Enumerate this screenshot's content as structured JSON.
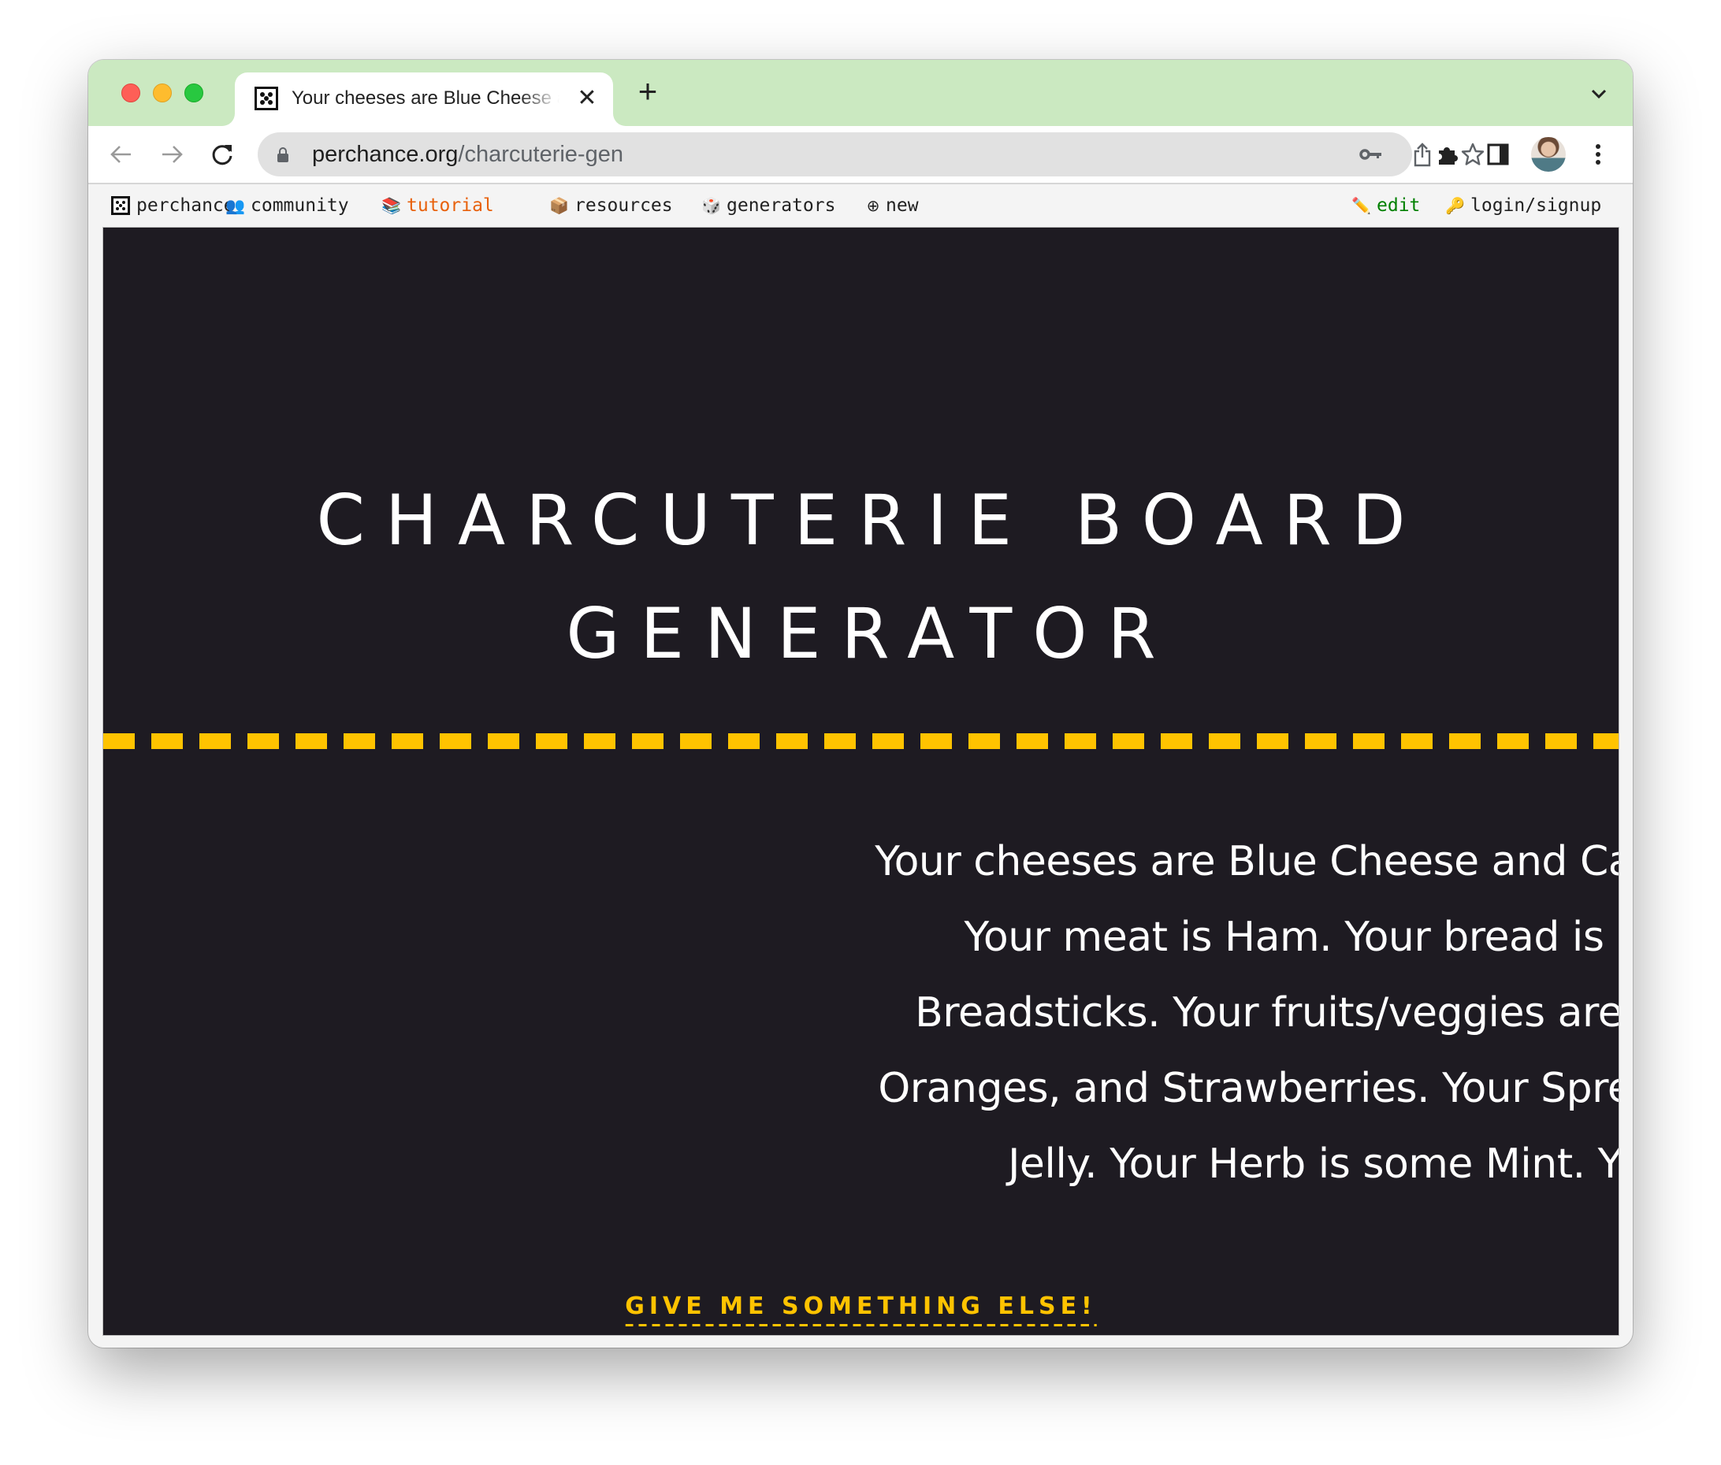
{
  "browser": {
    "tab": {
      "title": "Your cheeses are Blue Cheese and Camembert.",
      "favicon": "dice-icon",
      "close_label": "✕"
    },
    "new_tab_label": "+",
    "address": {
      "domain": "perchance.org",
      "path": "/charcuterie-gen"
    },
    "omnibox_icons": [
      "key-icon",
      "share-icon",
      "star-icon"
    ],
    "toolbar_icons": [
      "extensions-icon",
      "side-panel-icon",
      "profile-avatar",
      "menu-icon"
    ]
  },
  "bookmarks": {
    "left": [
      {
        "label": "perchance",
        "icon": "dice-icon",
        "color": "#222222"
      },
      {
        "label": "community",
        "icon": "👥",
        "color": "#222222"
      },
      {
        "label": "tutorial",
        "icon": "📚",
        "color": "#e8610c"
      },
      {
        "label": "resources",
        "icon": "📦",
        "color": "#222222"
      },
      {
        "label": "generators",
        "icon": "🎲",
        "color": "#222222"
      },
      {
        "label": "new",
        "icon": "⊕",
        "color": "#222222"
      }
    ],
    "right": [
      {
        "label": "edit",
        "icon": "✏️",
        "color": "#008000"
      },
      {
        "label": "login/signup",
        "icon": "🔑",
        "color": "#222222"
      }
    ]
  },
  "page": {
    "title_line1": "CHARCUTERIE BOARD",
    "title_line2": "GENERATOR",
    "result": "Your cheeses are Blue Cheese and Camembert. Your meat is Ham. Your bread is Crispy Breadsticks. Your fruits/veggies are Grapes, Oranges, and Strawberries. Your Spread is Fruit Jelly. Your Herb is some Mint. Yum!",
    "button_label": "GIVE ME SOMETHING ELSE!",
    "colors": {
      "background": "#1e1b22",
      "accent": "#ffc300",
      "text": "#ffffff"
    }
  }
}
